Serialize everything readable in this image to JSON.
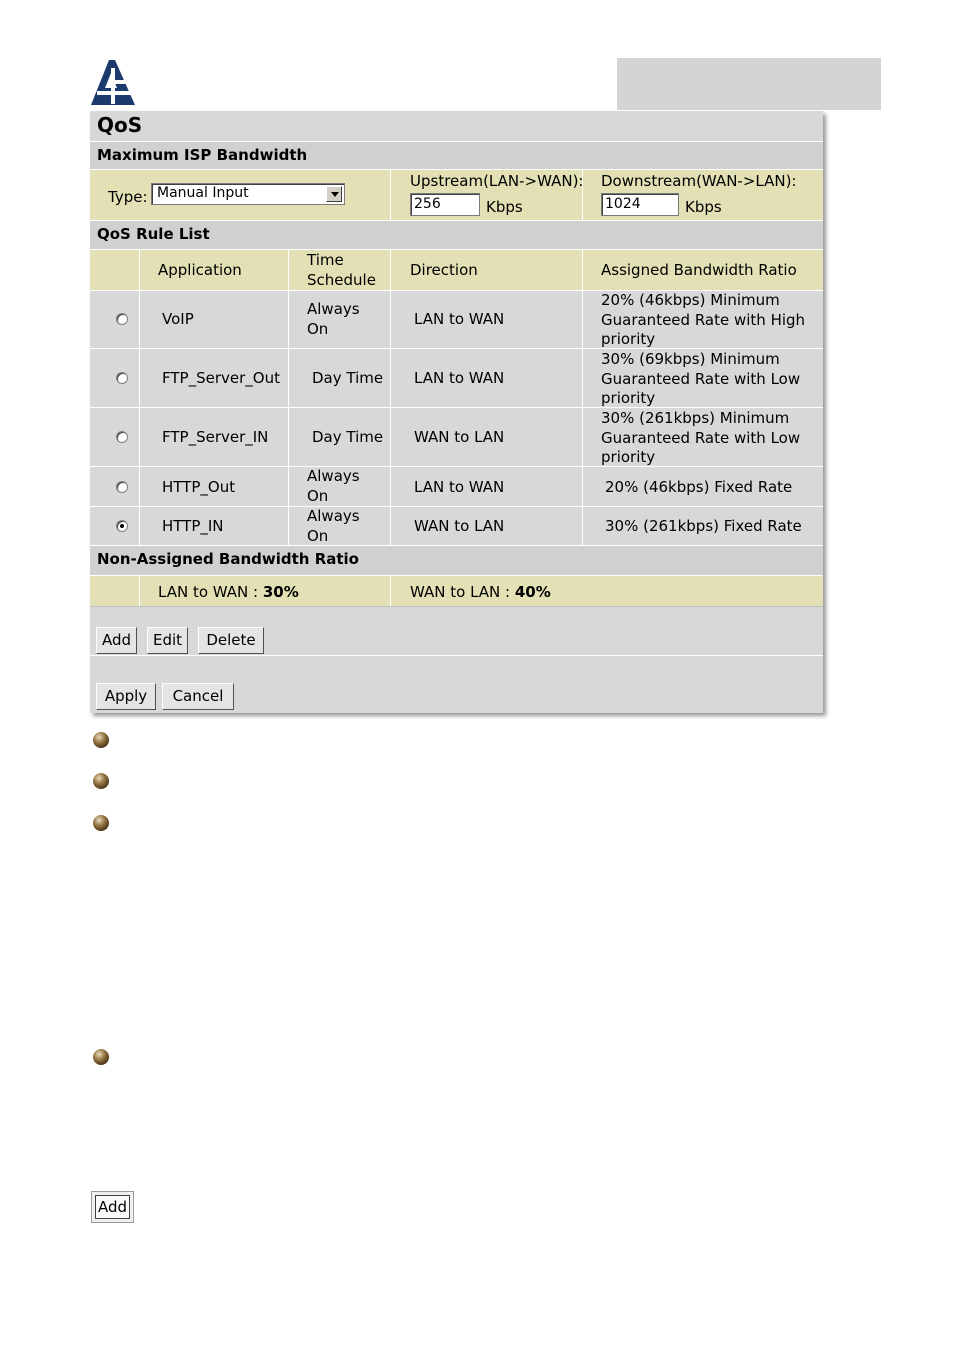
{
  "panel": {
    "title": "QoS",
    "isp_section": "Maximum ISP Bandwidth",
    "type_label": "Type:",
    "type_value": "Manual Input",
    "upstream_label": "Upstream(LAN->WAN):",
    "upstream_value": "256",
    "upstream_unit": "Kbps",
    "downstream_label": "Downstream(WAN->LAN):",
    "downstream_value": "1024",
    "downstream_unit": "Kbps",
    "rule_section": "QoS Rule List",
    "columns": [
      "Application",
      "Time Schedule",
      "Direction",
      "Assigned Bandwidth Ratio"
    ],
    "rows": [
      {
        "app": "VoIP",
        "time": "Always On",
        "dir": "LAN to WAN",
        "ratio": "20% (46kbps) Minimum Guaranteed Rate with High priority",
        "selected": false
      },
      {
        "app": "FTP_Server_Out",
        "time": "Day Time",
        "dir": "LAN to WAN",
        "ratio": "30% (69kbps) Minimum Guaranteed Rate with Low priority",
        "selected": false
      },
      {
        "app": "FTP_Server_IN",
        "time": "Day Time",
        "dir": "WAN to LAN",
        "ratio": "30% (261kbps) Minimum Guaranteed Rate with Low priority",
        "selected": false
      },
      {
        "app": "HTTP_Out",
        "time": "Always On",
        "dir": "LAN to WAN",
        "ratio": "20% (46kbps) Fixed Rate",
        "selected": false
      },
      {
        "app": "HTTP_IN",
        "time": "Always On",
        "dir": "WAN to LAN",
        "ratio": "30% (261kbps) Fixed Rate",
        "selected": true
      }
    ],
    "nonassigned_section": "Non-Assigned Bandwidth Ratio",
    "lan_wan_label": "LAN to WAN : ",
    "lan_wan_value": "30%",
    "wan_lan_label": "WAN to LAN : ",
    "wan_lan_value": "40%",
    "buttons": {
      "add": "Add",
      "edit": "Edit",
      "delete": "Delete",
      "apply": "Apply",
      "cancel": "Cancel"
    }
  },
  "standalone_add_button": "Add"
}
